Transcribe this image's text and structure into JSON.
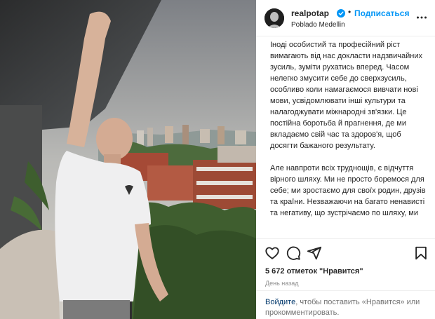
{
  "post": {
    "username": "realpotap",
    "follow_label": "Подписаться",
    "location": "Poblado Medellin",
    "caption_paragraphs": [
      "Іноді особистий та професійний ріст вимагають від нас докласти надзвичайних зусиль, зуміти рухатись вперед. Часом нелегко змусити себе до сверхзусиль, особливо коли намагаємося вивчати нові мови, усвідомлювати інші культури та налагоджувати міжнародні зв'язки. Це постійна боротьба й прагнення, де ми вкладаємо свій час та здоров'я, щоб досягти бажаного результату.",
      "Але навпроти всіх труднощів, є відчуття вірного шляху. Ми не просто боремося для себе; ми зростаємо для своїх родин, друзів та країни. Незважаючи на багато ненависті та негативу, що зустрічаємо по шляху, ми"
    ],
    "likes_text": "5 672 отметок \"Нравится\"",
    "time_ago": "День назад",
    "login_link": "Войдите",
    "login_text": ", чтобы поставить «Нравится» или прокомментировать."
  },
  "icons": {
    "verified": "verified-badge-icon",
    "more": "more-options-icon",
    "like": "heart-icon",
    "comment": "comment-icon",
    "share": "share-icon",
    "save": "bookmark-icon"
  },
  "colors": {
    "accent": "#0095f6",
    "text": "#262626",
    "muted": "#8e8e8e",
    "link": "#00376b"
  }
}
